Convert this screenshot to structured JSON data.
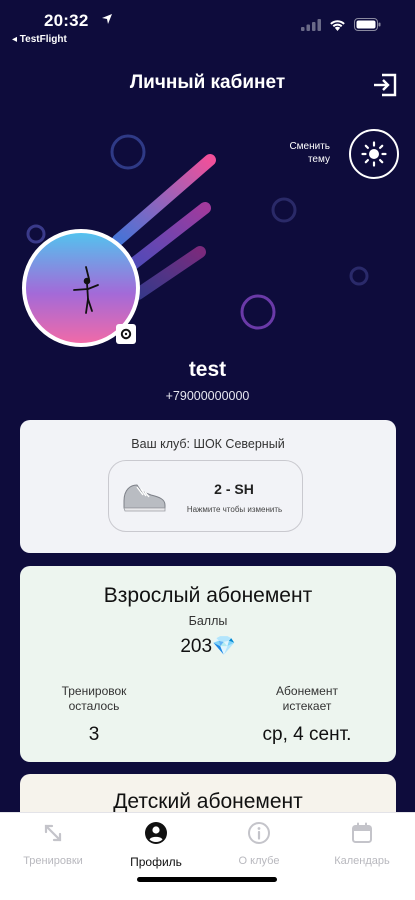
{
  "status_bar": {
    "time": "20:32",
    "back_app": "◂ TestFlight"
  },
  "header": {
    "title": "Личный кабинет"
  },
  "theme": {
    "label": "Сменить тему"
  },
  "user": {
    "name": "test",
    "phone": "+79000000000"
  },
  "club": {
    "title": "Ваш клуб: ШОК Северный",
    "name": "2 - SH",
    "hint": "Нажмите чтобы изменить"
  },
  "subscription": {
    "title": "Взрослый абонемент",
    "points_label": "Баллы",
    "points_value": "203💎",
    "trainings_label": "Тренировок осталось",
    "trainings_value": "3",
    "expires_label": "Абонемент истекает",
    "expires_value": "ср, 4 сент."
  },
  "kids_subscription": {
    "title": "Детский абонемент"
  },
  "tabs": [
    {
      "label": "Тренировки",
      "icon": "expand-arrows-icon",
      "active": false
    },
    {
      "label": "Профиль",
      "icon": "person-circle-icon",
      "active": true
    },
    {
      "label": "О клубе",
      "icon": "info-circle-icon",
      "active": false
    },
    {
      "label": "Календарь",
      "icon": "calendar-icon",
      "active": false
    }
  ],
  "colors": {
    "background": "#0e0c3c",
    "accent_pink": "#f0509a",
    "accent_blue": "#5aa8f0",
    "card_light": "#f2f3f7",
    "card_green": "#edf5ef"
  }
}
